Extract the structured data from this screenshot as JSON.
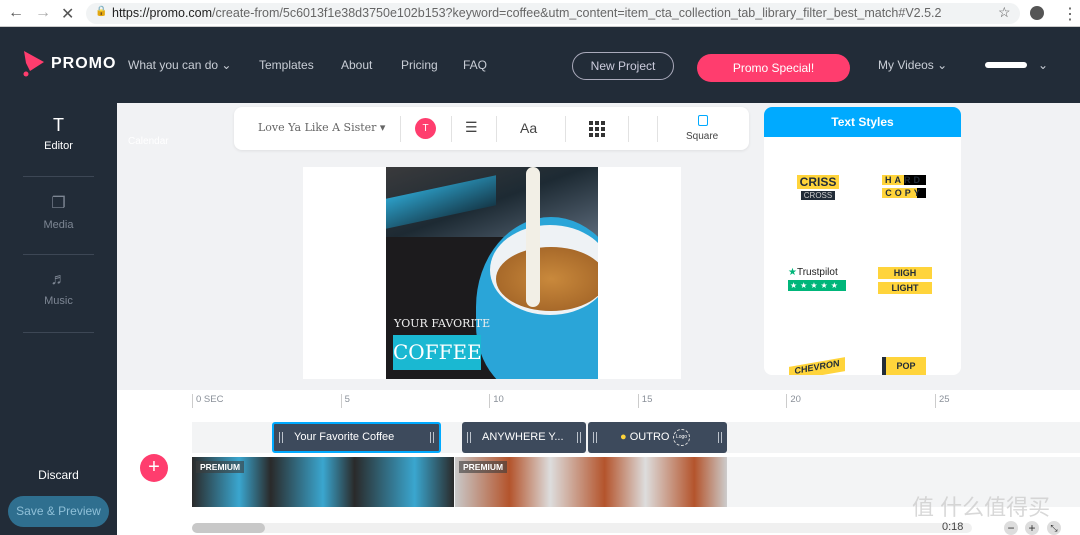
{
  "browser": {
    "url_host": "https://promo.com",
    "url_rest": "/create-from/5c6013f1e38d3750e102b153?keyword=coffee&utm_content=item_cta_collection_tab_library_filter_best_match#V2.5.2"
  },
  "nav": {
    "logo": "PROMO",
    "items": [
      {
        "label": "What you can do",
        "dropdown": true
      },
      {
        "label": "Templates"
      },
      {
        "label": "About"
      },
      {
        "label": "Pricing"
      },
      {
        "label": "FAQ"
      }
    ],
    "new_project": "New Project",
    "promo_special": "Promo Special!",
    "my_videos": "My Videos",
    "accent": "#ff3d6e"
  },
  "sidebar": {
    "items": [
      {
        "label": "Editor",
        "icon": "text-icon",
        "active": true
      },
      {
        "label": "Media",
        "icon": "media-icon"
      },
      {
        "label": "Music",
        "icon": "music-icon"
      }
    ],
    "discard": "Discard",
    "save_preview": "Save & Preview",
    "faint_label": "Calendar"
  },
  "toolbar": {
    "font": "Love Ya Like A Sister",
    "color_label": "T",
    "font_size_label": "Aa",
    "format": "Square"
  },
  "preview": {
    "line1": "YOUR FAVORITE",
    "line2": "COFFEE"
  },
  "text_styles": {
    "title": "Text Styles",
    "items": [
      {
        "l1": "CRISS",
        "l2": "CROSS"
      },
      {
        "l1": "HARD",
        "l2": "COPY"
      },
      {
        "l1": "Trustpilot"
      },
      {
        "l1": "HIGH",
        "l2": "LIGHT"
      },
      {
        "l1": "CHEVRON"
      },
      {
        "l1": "POP"
      }
    ]
  },
  "timeline": {
    "ticks": [
      "0 SEC",
      "5",
      "10",
      "15",
      "20",
      "25"
    ],
    "clips": [
      {
        "label": "Your Favorite Coffee",
        "selected": true
      },
      {
        "label": "ANYWHERE Y..."
      },
      {
        "label": "OUTRO",
        "badge": "Logo"
      }
    ],
    "premium": "PREMIUM",
    "time": "0:18"
  },
  "watermark": "值 什么值得买"
}
